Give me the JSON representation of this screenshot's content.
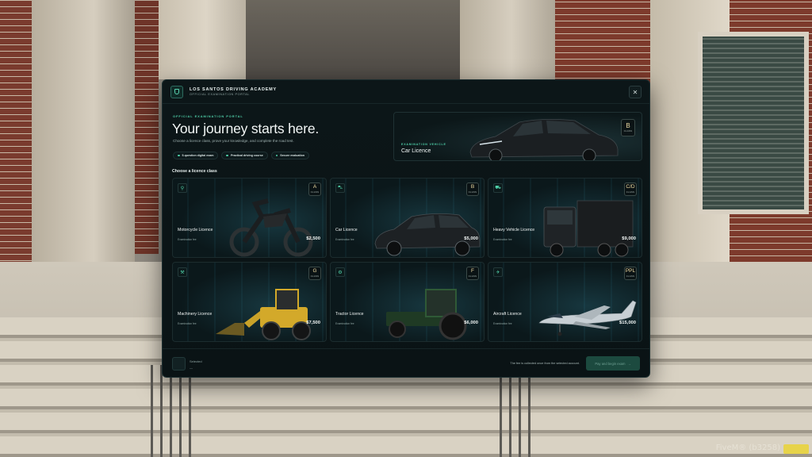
{
  "header": {
    "brand_name": "LOS SANTOS DRIVING ACADEMY",
    "brand_sub": "OFFICIAL EXAMINATION PORTAL",
    "close_glyph": "✕"
  },
  "hero": {
    "eyebrow": "OFFICIAL EXAMINATION PORTAL",
    "title": "Your journey starts here.",
    "description": "Choose a licence class, prove your knowledge, and complete the road test.",
    "chips": [
      "5-question digital exam",
      "Practical driving course",
      "Secure evaluation"
    ]
  },
  "featured": {
    "eyebrow": "EXAMINATION VEHICLE",
    "title": "Car Licence",
    "class_letter": "B",
    "class_word": "CLASS"
  },
  "section_label": "Choose a licence class",
  "class_word": "CLASS",
  "fee_label": "Examination fee",
  "cards": [
    {
      "title": "Motorcycle Licence",
      "class": "A",
      "price": "$2,500",
      "icon": "motorcycle-icon",
      "icon_glyph": "⚲"
    },
    {
      "title": "Car Licence",
      "class": "B",
      "price": "$5,000",
      "icon": "car-icon",
      "icon_glyph": "⛍"
    },
    {
      "title": "Heavy Vehicle Licence",
      "class": "C/D",
      "price": "$9,000",
      "icon": "truck-icon",
      "icon_glyph": "⛟"
    },
    {
      "title": "Machinery Licence",
      "class": "G",
      "price": "$7,500",
      "icon": "excavator-icon",
      "icon_glyph": "⚒"
    },
    {
      "title": "Tractor Licence",
      "class": "F",
      "price": "$6,000",
      "icon": "tractor-icon",
      "icon_glyph": "⚙"
    },
    {
      "title": "Aircraft Licence",
      "class": "PPL",
      "price": "$15,000",
      "icon": "plane-icon",
      "icon_glyph": "✈"
    }
  ],
  "footer": {
    "selected_label": "Selected",
    "selected_value": "—",
    "fee_note": "The fee is collected once from the selected account.",
    "pay_label": "Pay and begin exam",
    "pay_arrow": "→"
  },
  "overlay": {
    "watermark": "FiveM® (b3258)"
  },
  "colors": {
    "accent": "#4fd0a9",
    "panel_bg": "#0b1517",
    "badge_letter": "#f0dca3",
    "pay_button": "#1c4a3f"
  }
}
